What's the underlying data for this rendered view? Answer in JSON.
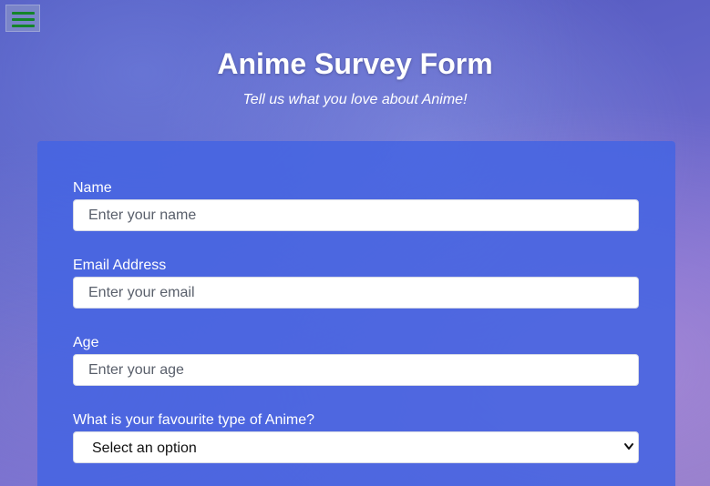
{
  "menu": {
    "icon": "hamburger-menu-icon",
    "icon_color": "#14842a"
  },
  "header": {
    "title": "Anime Survey Form",
    "subtitle": "Tell us what you love about Anime!"
  },
  "form": {
    "name": {
      "label": "Name",
      "placeholder": "Enter your name"
    },
    "email": {
      "label": "Email Address",
      "placeholder": "Enter your email"
    },
    "age": {
      "label": "Age",
      "placeholder": "Enter your age"
    },
    "favourite_type": {
      "label": "What is your favourite type of Anime?",
      "selected": "Select an option",
      "icon": "chevron-down-icon"
    }
  },
  "colors": {
    "card": "#4664e1",
    "text": "#ffffff"
  }
}
